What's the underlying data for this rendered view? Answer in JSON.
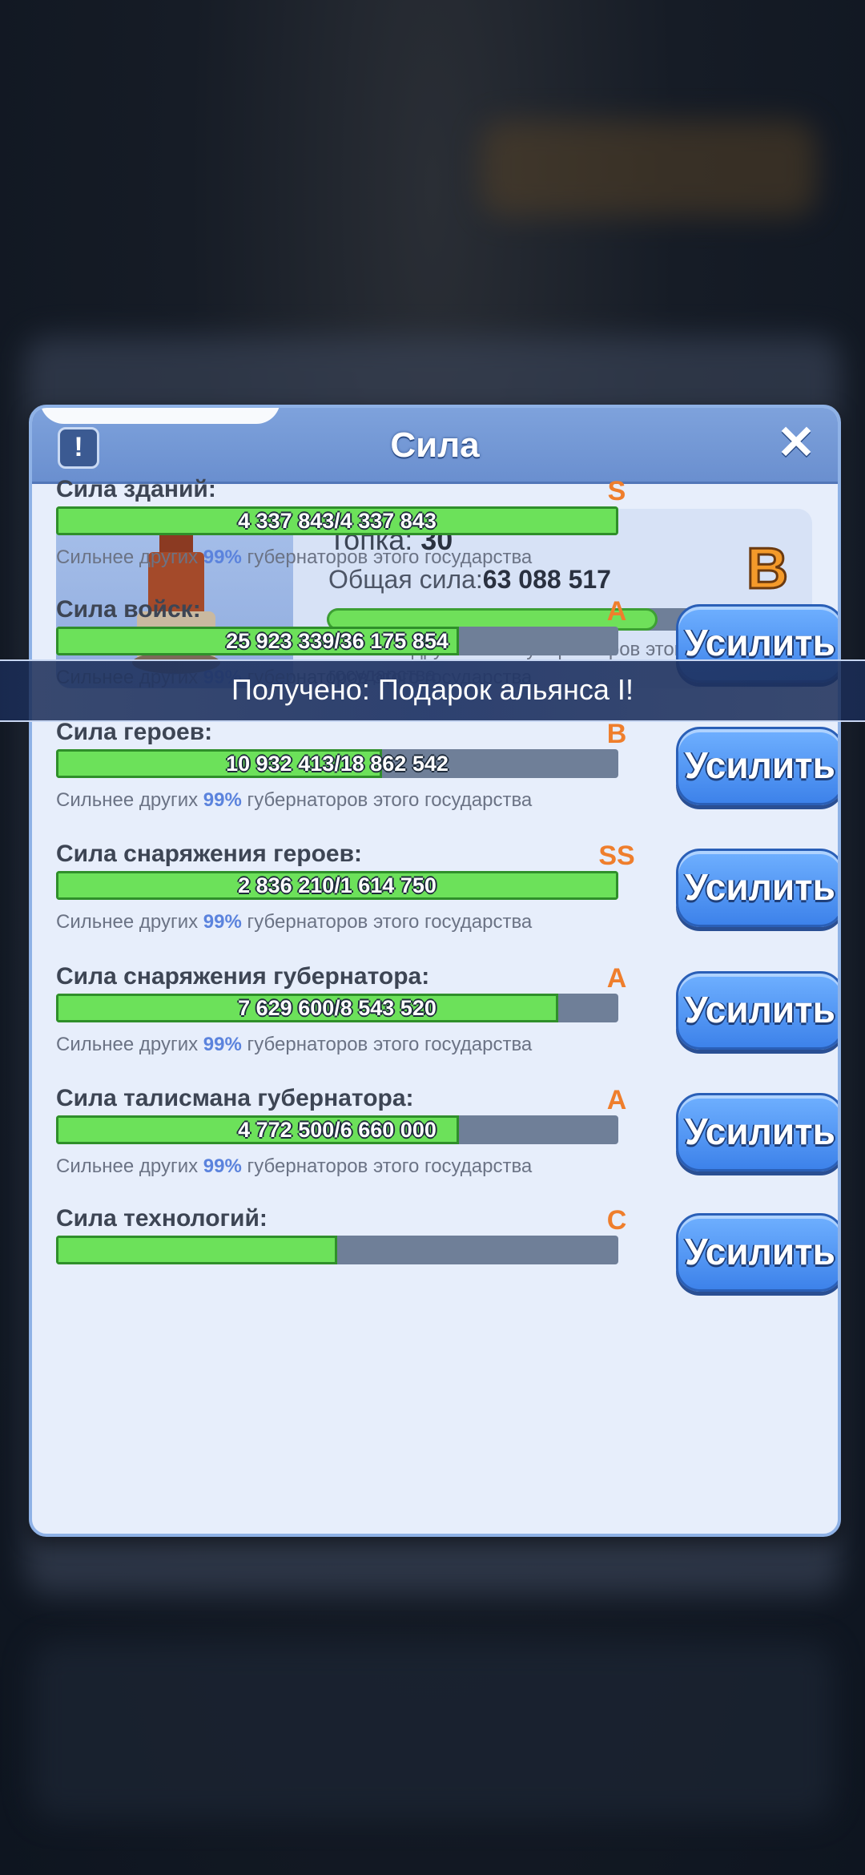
{
  "dialog": {
    "title": "Сила",
    "info_icon": "!",
    "close_icon": "✕"
  },
  "summary": {
    "level_label": "Топка:",
    "level_value": "30",
    "total_label": "Общая сила:",
    "total_value": "63 088 517",
    "grade": "B",
    "progress": 0.68,
    "note_prefix": "Сильнее других",
    "note_pct": "99%",
    "note_suffix": "губернаторов этого государства"
  },
  "banner": {
    "text": "Получено: Подарок альянса I!"
  },
  "rows": [
    {
      "label": "Сила зданий:",
      "grade": "S",
      "value": "4 337 843/4 337 843",
      "progress": 1.0,
      "note_prefix": "Сильнее других",
      "note_pct": "99%",
      "note_suffix": "губернаторов этого государства",
      "button": ""
    },
    {
      "label": "Сила войск:",
      "grade": "A",
      "value": "25 923 339/36 175 854",
      "progress": 0.717,
      "note_prefix": "Сильнее других",
      "note_pct": "99%",
      "note_suffix": "губернаторов этого государства",
      "button": "Усилить"
    },
    {
      "label": "Сила героев:",
      "grade": "B",
      "value": "10 932 413/18 862 542",
      "progress": 0.58,
      "note_prefix": "Сильнее других",
      "note_pct": "99%",
      "note_suffix": "губернаторов этого государства",
      "button": "Усилить"
    },
    {
      "label": "Сила снаряжения героев:",
      "grade": "SS",
      "value": "2 836 210/1 614 750",
      "progress": 1.0,
      "note_prefix": "Сильнее других",
      "note_pct": "99%",
      "note_suffix": "губернаторов этого государства",
      "button": "Усилить"
    },
    {
      "label": "Сила снаряжения губернатора:",
      "grade": "A",
      "value": "7 629 600/8 543 520",
      "progress": 0.893,
      "note_prefix": "Сильнее других",
      "note_pct": "99%",
      "note_suffix": "губернаторов этого государства",
      "button": "Усилить"
    },
    {
      "label": "Сила талисмана губернатора:",
      "grade": "A",
      "value": "4 772 500/6 660 000",
      "progress": 0.717,
      "note_prefix": "Сильнее других",
      "note_pct": "99%",
      "note_suffix": "губернаторов этого государства",
      "button": "Усилить"
    },
    {
      "label": "Сила технологий:",
      "grade": "C",
      "value": "",
      "progress": 0.5,
      "note_prefix": "",
      "note_pct": "",
      "note_suffix": "",
      "button": "Усилить"
    }
  ]
}
